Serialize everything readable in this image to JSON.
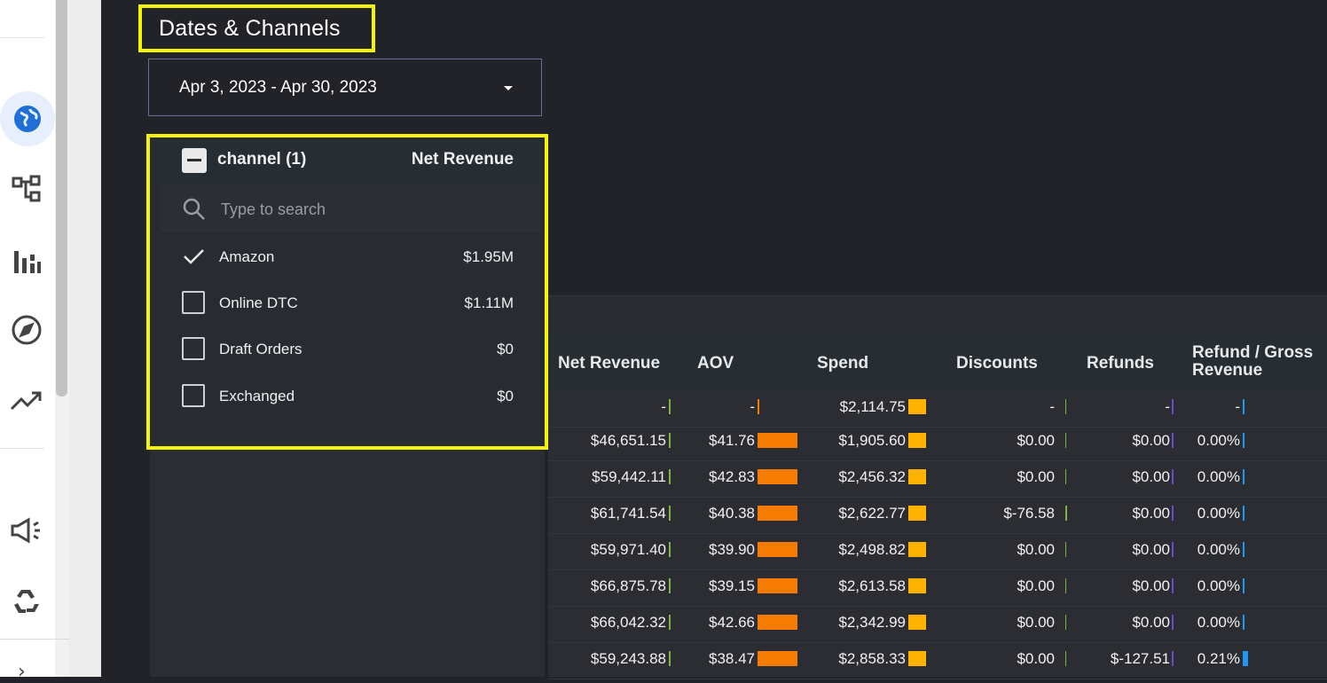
{
  "panel_title": "Dates & Channels",
  "date_range": "Apr 3, 2023 - Apr 30, 2023",
  "channel_filter": {
    "header_label": "channel (1)",
    "header_metric": "Net Revenue",
    "search_placeholder": "Type to search",
    "options": [
      {
        "label": "Amazon",
        "value": "$1.95M",
        "checked": true
      },
      {
        "label": "Online DTC",
        "value": "$1.11M",
        "checked": false
      },
      {
        "label": "Draft Orders",
        "value": "$0",
        "checked": false
      },
      {
        "label": "Exchanged",
        "value": "$0",
        "checked": false
      }
    ]
  },
  "table": {
    "columns": [
      "Net Revenue",
      "AOV",
      "Spend",
      "Discounts",
      "Refunds",
      "Refund / Gross",
      "Revenue"
    ],
    "rows": [
      [
        "-",
        "-",
        "$2,114.75",
        "-",
        "-",
        "-"
      ],
      [
        "$46,651.15",
        "$41.76",
        "$1,905.60",
        "$0.00",
        "$0.00",
        "0.00%"
      ],
      [
        "$59,442.11",
        "$42.83",
        "$2,456.32",
        "$0.00",
        "$0.00",
        "0.00%"
      ],
      [
        "$61,741.54",
        "$40.38",
        "$2,622.77",
        "$-76.58",
        "$0.00",
        "0.00%"
      ],
      [
        "$59,971.40",
        "$39.90",
        "$2,498.82",
        "$0.00",
        "$0.00",
        "0.00%"
      ],
      [
        "$66,875.78",
        "$39.15",
        "$2,613.58",
        "$0.00",
        "$0.00",
        "0.00%"
      ],
      [
        "$66,042.32",
        "$42.66",
        "$2,342.99",
        "$0.00",
        "$0.00",
        "0.00%"
      ],
      [
        "$59,243.88",
        "$38.47",
        "$2,858.33",
        "$0.00",
        "$-127.51",
        "0.21%"
      ]
    ]
  },
  "colors": {
    "net_revenue_bar": "#7cb342",
    "aov_bar": "#f57c00",
    "spend_bar": "#ffb300",
    "discount_bar": "#7cb342",
    "refund_bar": "#6a4ccf",
    "ratio_bar": "#2196f3",
    "highlight": "#f5f500"
  }
}
